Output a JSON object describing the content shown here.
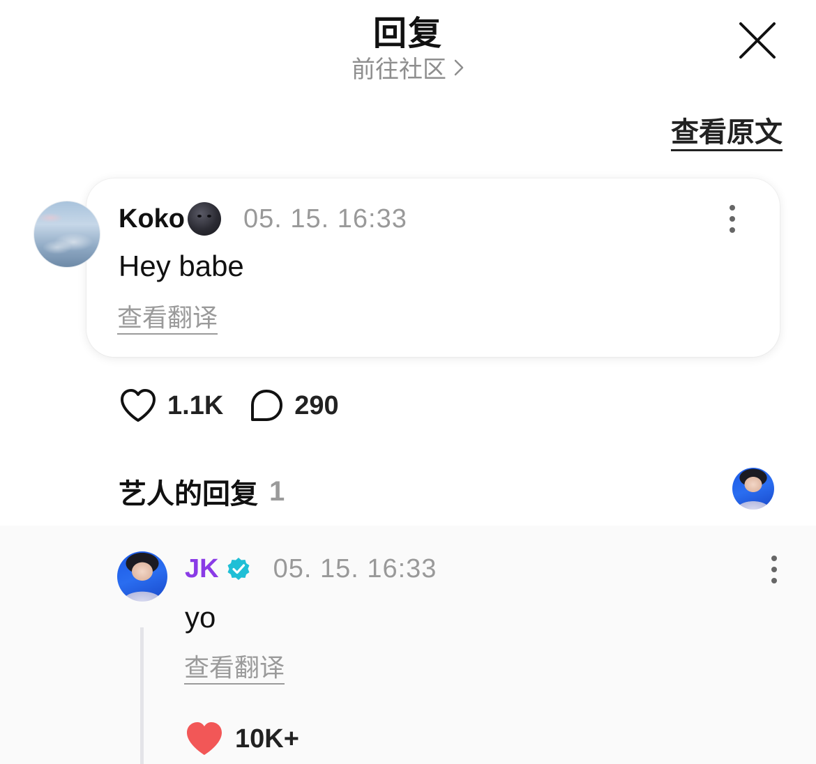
{
  "header": {
    "title": "回复",
    "community_link": "前往社区",
    "close_icon": "close-icon"
  },
  "view_original": "查看原文",
  "post": {
    "username": "Koko",
    "username_emoji": "new-moon-face-icon",
    "timestamp": "05. 15. 16:33",
    "text": "Hey babe",
    "translate_label": "查看翻译",
    "likes": "1.1K",
    "comments": "290"
  },
  "artist_section": {
    "title": "艺人的回复",
    "count": "1"
  },
  "reply": {
    "artist_name": "JK",
    "verified_icon": "verified-badge-icon",
    "timestamp": "05. 15. 16:33",
    "text": "yo",
    "translate_label": "查看翻译",
    "likes": "10K+"
  },
  "colors": {
    "artist_name": "#8a3be6",
    "verified_badge": "#1fbfd6",
    "liked_heart": "#f25757",
    "muted_text": "#9a9a9a"
  }
}
